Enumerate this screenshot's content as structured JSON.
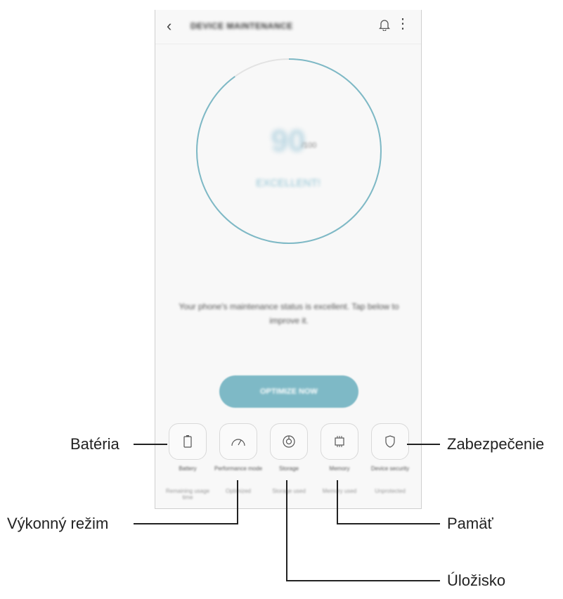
{
  "app": {
    "title": "DEVICE MAINTENANCE",
    "score": "90",
    "score_max": "/100",
    "status_word": "EXCELLENT!",
    "message": "Your phone's maintenance status is excellent. Tap below to improve it.",
    "optimize_label": "OPTIMIZE NOW",
    "score_fraction": 0.9,
    "accent_color": "#7eb9c6"
  },
  "tiles": [
    {
      "label": "Battery",
      "sub": "Remaining usage time",
      "icon": "battery-icon"
    },
    {
      "label": "Performance mode",
      "sub": "Optimized",
      "icon": "speedometer-icon"
    },
    {
      "label": "Storage",
      "sub": "Storage used",
      "icon": "storage-icon"
    },
    {
      "label": "Memory",
      "sub": "Memory used",
      "icon": "memory-chip-icon"
    },
    {
      "label": "Device security",
      "sub": "Unprotected",
      "icon": "shield-icon"
    }
  ],
  "callouts": {
    "bateria": "Batéria",
    "vykonny_rezim": "Výkonný režim",
    "ulozisko": "Úložisko",
    "pamat": "Pamäť",
    "zabezpecenie": "Zabezpečenie"
  }
}
